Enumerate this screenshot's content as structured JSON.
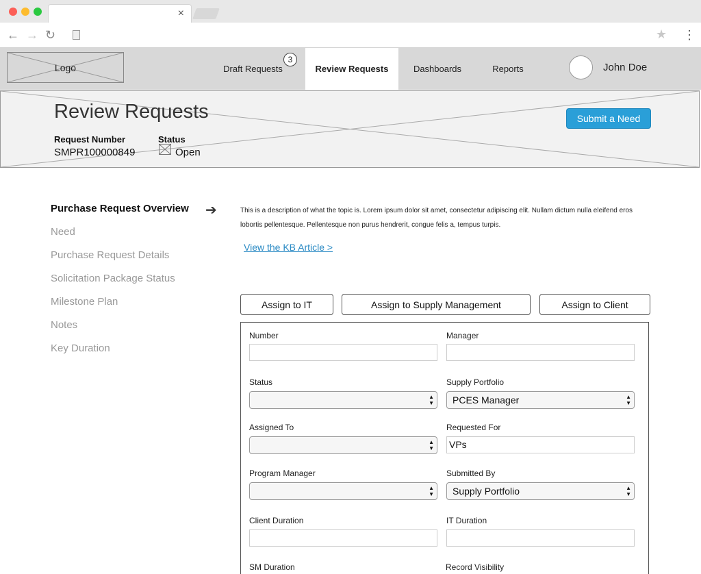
{
  "browser": {
    "tab_close": "×",
    "back_icon": "←",
    "forward_icon": "→",
    "reload_icon": "↻",
    "star_icon": "★",
    "menu_icon": "⋮"
  },
  "header": {
    "logo_label": "Logo",
    "nav": [
      {
        "label": "Draft Requests",
        "badge": "3"
      },
      {
        "label": "Review Requests",
        "active": true
      },
      {
        "label": "Dashboards"
      },
      {
        "label": "Reports"
      }
    ],
    "user_name": "John Doe"
  },
  "banner": {
    "title": "Review Requests",
    "request_number_label": "Request Number",
    "request_number": "SMPR100000849",
    "status_label": "Status",
    "status": "Open",
    "submit_label": "Submit a Need",
    "accent_color": "#2a9fd8"
  },
  "sidebar": {
    "items": [
      {
        "label": "Purchase Request Overview",
        "active": true
      },
      {
        "label": "Need"
      },
      {
        "label": "Purchase Request Details"
      },
      {
        "label": "Solicitation Package Status"
      },
      {
        "label": "Milestone Plan"
      },
      {
        "label": "Notes"
      },
      {
        "label": "Key Duration"
      }
    ],
    "arrow_icon": "➔"
  },
  "main": {
    "description": "This is a description of what the topic is. Lorem ipsum dolor sit amet, consectetur adipiscing elit. Nullam dictum nulla eleifend eros lobortis pellentesque. Pellentesque non purus hendrerit, congue felis a, tempus turpis.",
    "kb_link": "View the KB Article  >",
    "actions": {
      "assign_it": "Assign to IT",
      "assign_sm": "Assign to Supply Management",
      "assign_client": "Assign to Client"
    },
    "form": {
      "number": {
        "label": "Number",
        "value": ""
      },
      "manager": {
        "label": "Manager",
        "value": ""
      },
      "status": {
        "label": "Status",
        "value": ""
      },
      "supply_portfolio": {
        "label": "Supply Portfolio",
        "value": "PCES Manager"
      },
      "assigned_to": {
        "label": "Assigned To",
        "value": ""
      },
      "requested_for": {
        "label": "Requested For",
        "value": "VPs"
      },
      "program_manager": {
        "label": "Program Manager",
        "value": ""
      },
      "submitted_by": {
        "label": "Submitted By",
        "value": "Supply Portfolio"
      },
      "client_duration": {
        "label": "Client Duration",
        "value": ""
      },
      "it_duration": {
        "label": "IT Duration",
        "value": ""
      },
      "sm_duration": {
        "label": "SM Duration"
      },
      "record_visibility": {
        "label": "Record Visibility"
      }
    }
  }
}
